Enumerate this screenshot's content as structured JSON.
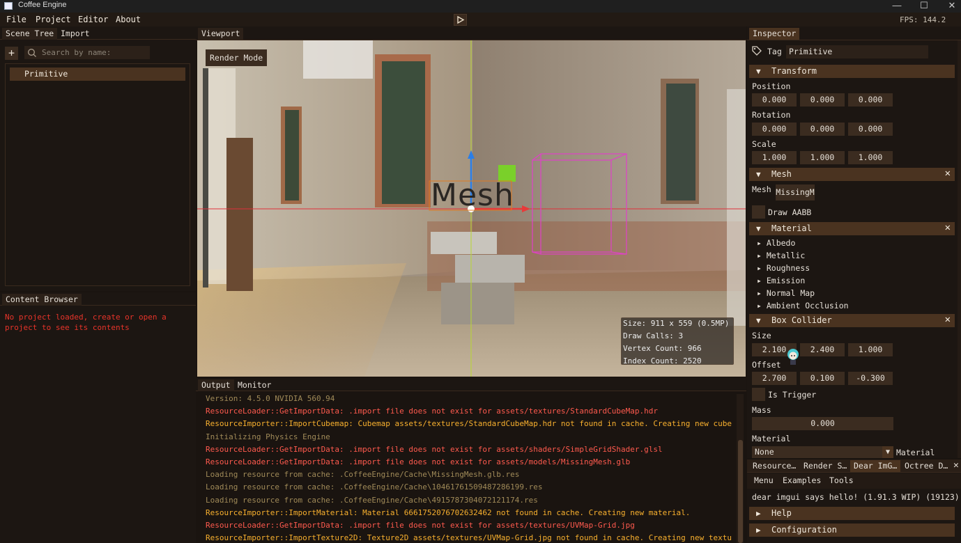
{
  "window": {
    "title": "Coffee Engine",
    "minimize": "—",
    "maximize": "☐",
    "close": "✕"
  },
  "menu": [
    "File",
    "Project",
    "Editor",
    "About"
  ],
  "fps_label": "FPS: 144.2",
  "scene_tree": {
    "tabs": [
      "Scene Tree",
      "Import"
    ],
    "add": "+",
    "search_placeholder": "Search by name:",
    "items": [
      "Primitive"
    ]
  },
  "content_browser": {
    "tab": "Content Browser",
    "message_line1": "No project loaded, create or open a",
    "message_line2": "project to see its contents"
  },
  "viewport": {
    "tab": "Viewport",
    "render_mode": "Render Mode",
    "label_text": "Mesh",
    "stats": {
      "size": "Size: 911 x 559 (0.5MP)",
      "draw_calls": "Draw Calls: 3",
      "vertex_count": "Vertex Count: 966",
      "index_count": "Index Count: 2520"
    }
  },
  "output": {
    "tabs": [
      "Output",
      "Monitor"
    ],
    "lines": [
      {
        "cls": "lg-dim",
        "text": "   Version: 4.5.0 NVIDIA 560.94"
      },
      {
        "cls": "lg-err",
        "text": "ResourceLoader::GetImportData: .import file does not exist for assets/textures/StandardCubeMap.hdr"
      },
      {
        "cls": "lg-imp",
        "text": "ResourceImporter::ImportCubemap: Cubemap assets/textures/StandardCubeMap.hdr not found in cache. Creating new cube"
      },
      {
        "cls": "lg-dim",
        "text": "Initializing Physics Engine"
      },
      {
        "cls": "lg-err",
        "text": "ResourceLoader::GetImportData: .import file does not exist for assets/shaders/SimpleGridShader.glsl"
      },
      {
        "cls": "lg-err",
        "text": "ResourceLoader::GetImportData: .import file does not exist for assets/models/MissingMesh.glb"
      },
      {
        "cls": "lg-dim",
        "text": "Loading resource from cache: .CoffeeEngine/Cache\\MissingMesh.glb.res"
      },
      {
        "cls": "lg-dim",
        "text": "Loading resource from cache: .CoffeeEngine/Cache\\10461761509487286199.res"
      },
      {
        "cls": "lg-dim",
        "text": "Loading resource from cache: .CoffeeEngine/Cache\\4915787304072121174.res"
      },
      {
        "cls": "lg-imp",
        "text": "ResourceImporter::ImportMaterial: Material 6661752076702632462 not found in cache. Creating new material."
      },
      {
        "cls": "lg-err",
        "text": "ResourceLoader::GetImportData: .import file does not exist for assets/textures/UVMap-Grid.jpg"
      },
      {
        "cls": "lg-imp",
        "text": "ResourceImporter::ImportTexture2D: Texture2D assets/textures/UVMap-Grid.jpg not found in cache. Creating new textu"
      }
    ]
  },
  "inspector": {
    "tab": "Inspector",
    "tag_label": "Tag",
    "tag_value": "Primitive",
    "transform": {
      "title": "Transform",
      "position_label": "Position",
      "position": [
        "0.000",
        "0.000",
        "0.000"
      ],
      "rotation_label": "Rotation",
      "rotation": [
        "0.000",
        "0.000",
        "0.000"
      ],
      "scale_label": "Scale",
      "scale": [
        "1.000",
        "1.000",
        "1.000"
      ]
    },
    "mesh": {
      "title": "Mesh",
      "mesh_label": "Mesh",
      "mesh_value": "MissingM",
      "draw_aabb": "Draw AABB"
    },
    "material": {
      "title": "Material",
      "items": [
        "Albedo",
        "Metallic",
        "Roughness",
        "Emission",
        "Normal Map",
        "Ambient Occlusion"
      ]
    },
    "box_collider": {
      "title": "Box Collider",
      "size_label": "Size",
      "size": [
        "2.100",
        "2.400",
        "1.000"
      ],
      "offset_label": "Offset",
      "offset": [
        "2.700",
        "0.100",
        "-0.300"
      ],
      "is_trigger": "Is Trigger",
      "mass_label": "Mass",
      "mass": "0.000",
      "material_label": "Material",
      "material_value": "None",
      "material_combo_label": "Material"
    }
  },
  "imgui": {
    "tabs": [
      "Resource…",
      "Render S…",
      "Dear ImG…",
      "Octree D…"
    ],
    "menu": [
      "Menu",
      "Examples",
      "Tools"
    ],
    "hello": "dear imgui says hello! (1.91.3 WIP) (19123)",
    "sections": [
      "Help",
      "Configuration"
    ]
  },
  "colors": {
    "accent": "#4a3320",
    "bg": "#1c1612",
    "error": "#ff5a4e",
    "warning": "#f8b02e"
  }
}
